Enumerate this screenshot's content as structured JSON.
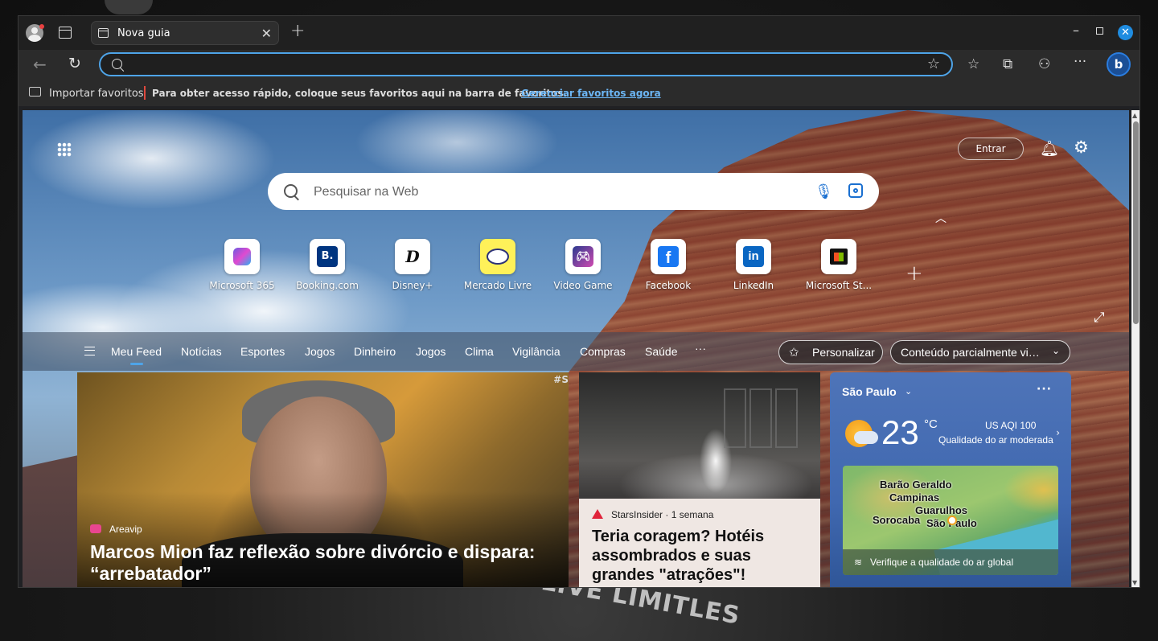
{
  "browser": {
    "tab_title": "Nova guia",
    "address_value": "",
    "favorites_bar": {
      "import_label": "Importar favoritos",
      "message": "Para obter acesso rápido, coloque seus favoritos aqui na barra de favoritos.",
      "manage_link": "Gerenciar favoritos agora"
    },
    "colors": {
      "accent": "#4ea4e8",
      "window_bg": "#202124",
      "close_button": "#1f8ce0"
    }
  },
  "newtab": {
    "signin_label": "Entrar",
    "search_placeholder": "Pesquisar na Web",
    "quick_links": [
      {
        "label": "Microsoft 365",
        "icon": "microsoft-365-icon"
      },
      {
        "label": "Booking.com",
        "icon": "booking-icon"
      },
      {
        "label": "Disney+",
        "icon": "disney-plus-icon"
      },
      {
        "label": "Mercado Livre",
        "icon": "mercado-livre-icon"
      },
      {
        "label": "Video Game",
        "icon": "video-game-icon"
      },
      {
        "label": "Facebook",
        "icon": "facebook-icon"
      },
      {
        "label": "LinkedIn",
        "icon": "linkedin-icon"
      },
      {
        "label": "Microsoft St...",
        "icon": "microsoft-store-icon"
      }
    ],
    "feed_tabs": [
      "Meu Feed",
      "Notícias",
      "Esportes",
      "Jogos",
      "Dinheiro",
      "Jogos",
      "Clima",
      "Vigilância",
      "Compras",
      "Saúde"
    ],
    "feed_more": "···",
    "personalize_label": "Personalizar",
    "content_select_label": "Conteúdo parcialmente visível"
  },
  "cards": {
    "main": {
      "source": "Areavip",
      "headline": "Marcos Mion faz reflexão sobre divórcio e dispara: “arrebatador”",
      "tag": "#S"
    },
    "mid": {
      "source": "StarsInsider · 1 semana",
      "headline": "Teria coragem? Hotéis assombrados e suas grandes \"atrações\"!"
    },
    "weather": {
      "city": "São Paulo",
      "temperature": "23",
      "unit": "°C",
      "aqi": "US AQI 100",
      "aqi_desc": "Qualidade do ar moderada",
      "map_labels": [
        "Barão Geraldo",
        "Campinas",
        "Guarulhos",
        "Sorocaba",
        "São Paulo"
      ],
      "map_footer": "Verifique a qualidade do ar global"
    }
  },
  "background_text": "OR LIVE LIMITLES"
}
